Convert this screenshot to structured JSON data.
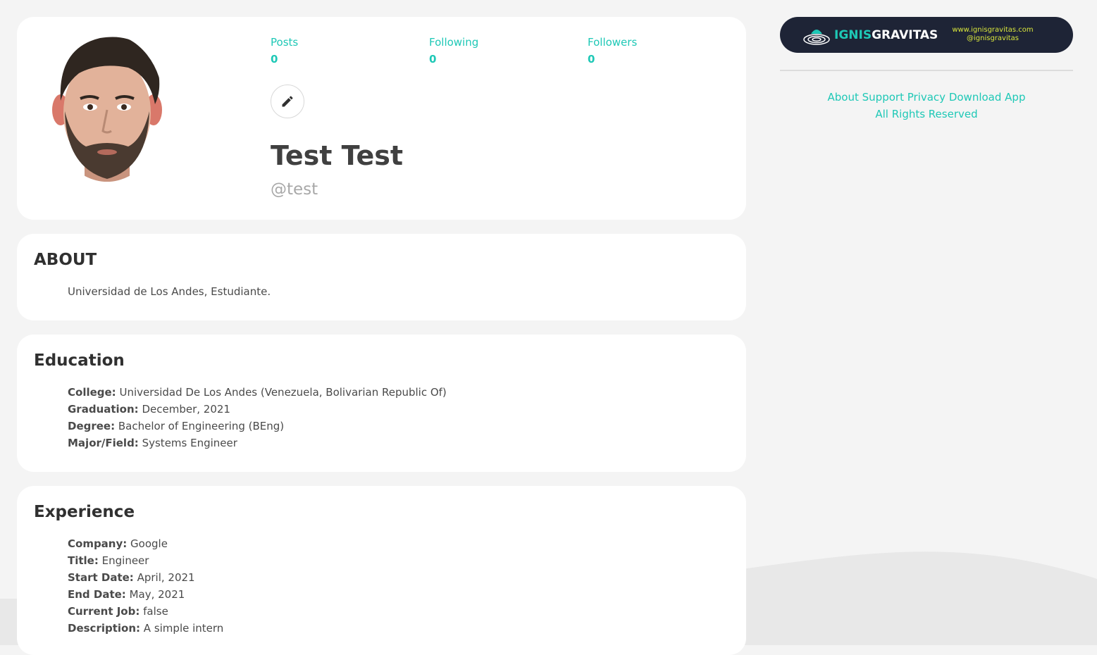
{
  "profile": {
    "stats": [
      {
        "label": "Posts",
        "value": "0"
      },
      {
        "label": "Following",
        "value": "0"
      },
      {
        "label": "Followers",
        "value": "0"
      }
    ],
    "full_name": "Test Test",
    "username": "@test"
  },
  "about": {
    "title": "ABOUT",
    "text": "Universidad de Los Andes, Estudiante."
  },
  "education": {
    "title": "Education",
    "fields": [
      {
        "key": "College:",
        "value": "Universidad De Los Andes (Venezuela, Bolivarian Republic Of)"
      },
      {
        "key": "Graduation:",
        "value": "December, 2021"
      },
      {
        "key": "Degree:",
        "value": "Bachelor of Engineering (BEng)"
      },
      {
        "key": "Major/Field:",
        "value": "Systems Engineer"
      }
    ]
  },
  "experience": {
    "title": "Experience",
    "fields": [
      {
        "key": "Company:",
        "value": "Google"
      },
      {
        "key": "Title:",
        "value": "Engineer"
      },
      {
        "key": "Start Date:",
        "value": "April, 2021"
      },
      {
        "key": "End Date:",
        "value": "May, 2021"
      },
      {
        "key": "Current Job:",
        "value": "false"
      },
      {
        "key": "Description:",
        "value": "A simple intern"
      }
    ]
  },
  "banner": {
    "brand_part1": "IGNIS",
    "brand_part2": "GRAVITAS",
    "url": "www.ignisgravitas.com",
    "handle": "@ignisgravitas"
  },
  "footer": {
    "links": [
      "About",
      "Support",
      "Privacy",
      "Download App"
    ],
    "rights": "All Rights Reserved"
  },
  "colors": {
    "accent": "#1ec8b6",
    "banner_bg": "#1e2436",
    "banner_text": "#d9e63c",
    "background": "#f4f4f4"
  },
  "icons": {
    "edit": "pencil-icon",
    "logo": "ignisgravitas-logo-icon"
  }
}
